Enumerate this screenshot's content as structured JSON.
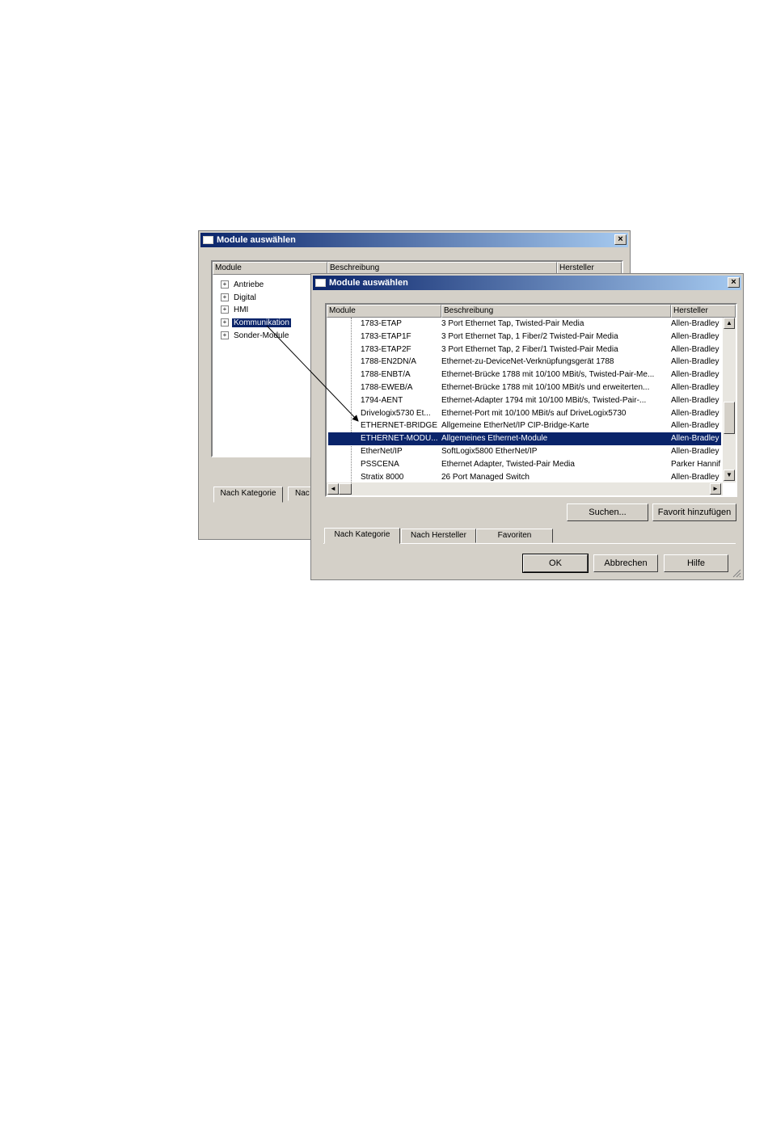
{
  "back_window": {
    "title": "Module auswählen",
    "close": "×",
    "columns": [
      "Module",
      "Beschreibung",
      "Hersteller"
    ],
    "tree": [
      {
        "label": "Antriebe",
        "expander": "+"
      },
      {
        "label": "Digital",
        "expander": "+"
      },
      {
        "label": "HMI",
        "expander": "+"
      },
      {
        "label": "Kommunikation",
        "expander": "+",
        "selected": true
      },
      {
        "label": "Sonder-Module",
        "expander": "+"
      }
    ],
    "tabs": [
      "Nach Kategorie",
      "Nac"
    ]
  },
  "front_window": {
    "title": "Module auswählen",
    "close": "×",
    "columns": [
      "Module",
      "Beschreibung",
      "Hersteller"
    ],
    "rows": [
      [
        "1783-ETAP",
        "3 Port Ethernet Tap, Twisted-Pair Media",
        "Allen-Bradley"
      ],
      [
        "1783-ETAP1F",
        "3 Port Ethernet Tap, 1 Fiber/2 Twisted-Pair Media",
        "Allen-Bradley"
      ],
      [
        "1783-ETAP2F",
        "3 Port Ethernet Tap, 2 Fiber/1 Twisted-Pair Media",
        "Allen-Bradley"
      ],
      [
        "1788-EN2DN/A",
        "Ethernet-zu-DeviceNet-Verknüpfungsgerät 1788",
        "Allen-Bradley"
      ],
      [
        "1788-ENBT/A",
        "Ethernet-Brücke 1788 mit 10/100 MBit/s, Twisted-Pair-Me...",
        "Allen-Bradley"
      ],
      [
        "1788-EWEB/A",
        "Ethernet-Brücke 1788 mit 10/100 MBit/s und erweiterten...",
        "Allen-Bradley"
      ],
      [
        "1794-AENT",
        "Ethernet-Adapter 1794 mit 10/100 MBit/s, Twisted-Pair-...",
        "Allen-Bradley"
      ],
      [
        "Drivelogix5730 Et...",
        "Ethernet-Port mit 10/100 MBit/s auf DriveLogix5730",
        "Allen-Bradley"
      ],
      [
        "ETHERNET-BRIDGE",
        "Allgemeine EtherNet/IP CIP-Bridge-Karte",
        "Allen-Bradley"
      ],
      [
        "ETHERNET-MODU...",
        "Allgemeines Ethernet-Module",
        "Allen-Bradley"
      ],
      [
        "EtherNet/IP",
        "SoftLogix5800 EtherNet/IP",
        "Allen-Bradley"
      ],
      [
        "PSSCENA",
        "Ethernet Adapter, Twisted-Pair Media",
        "Parker Hannif"
      ],
      [
        "Stratix 8000",
        "26 Port Managed Switch",
        "Allen-Bradley"
      ]
    ],
    "selected_row": 9,
    "buttons": {
      "search": "Suchen...",
      "add_favorite": "Favorit hinzufügen",
      "ok": "OK",
      "cancel": "Abbrechen",
      "help": "Hilfe"
    },
    "tabs": [
      "Nach Kategorie",
      "Nach Hersteller",
      "Favoriten"
    ],
    "scroll": {
      "up": "▲",
      "down": "▼",
      "left": "◄",
      "right": "►"
    }
  }
}
